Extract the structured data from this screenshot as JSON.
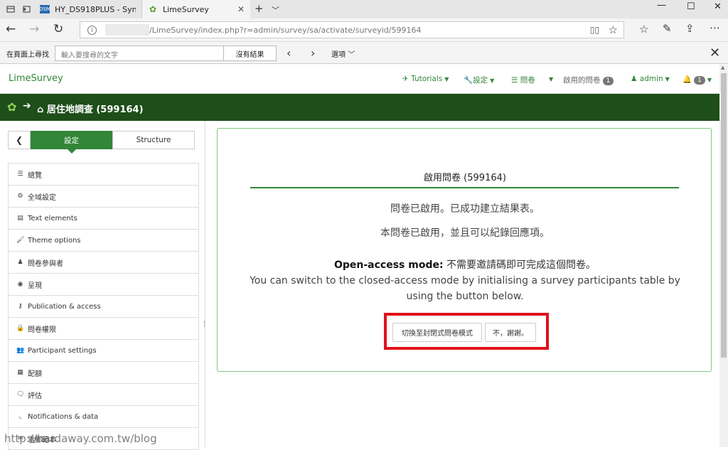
{
  "browser": {
    "tabs": [
      {
        "title": "HY_DS918PLUS - Synology DiskStation",
        "favicon": "DSM"
      },
      {
        "title": "LimeSurvey",
        "active": true
      }
    ],
    "url": "/LimeSurvey/index.php?r=admin/survey/sa/activate/surveyid/599164",
    "find": {
      "label": "在頁面上尋找",
      "placeholder": "輸入要搜尋的文字",
      "result": "沒有結果",
      "options": "選項"
    }
  },
  "nav": {
    "brand": "LimeSurvey",
    "tutorials": "Tutorials",
    "settings": "設定",
    "surveys": "問卷",
    "active_surveys": "啟用的問卷",
    "active_surveys_count": "1",
    "user": "admin",
    "notifications_count": "1"
  },
  "survey_bar": {
    "title": "居住地調查 (599164)"
  },
  "sidebar": {
    "tab_settings": "設定",
    "tab_structure": "Structure",
    "items": [
      {
        "label": "總覽",
        "icon": "list-icon"
      },
      {
        "label": "全域設定",
        "icon": "cogs-icon"
      },
      {
        "label": "Text elements",
        "icon": "file-text-icon"
      },
      {
        "label": "Theme options",
        "icon": "paint-brush-icon"
      },
      {
        "label": "問卷參與者",
        "icon": "user-icon"
      },
      {
        "label": "呈現",
        "icon": "eye-slash-icon"
      },
      {
        "label": "Publication & access",
        "icon": "key-icon"
      },
      {
        "label": "問卷權限",
        "icon": "lock-icon"
      },
      {
        "label": "Participant settings",
        "icon": "users-icon"
      },
      {
        "label": "配額",
        "icon": "tasks-icon"
      },
      {
        "label": "評估",
        "icon": "comment-icon"
      },
      {
        "label": "Notifications & data",
        "icon": "feed-icon"
      },
      {
        "label": "電郵範本",
        "icon": "envelope-icon"
      }
    ]
  },
  "card": {
    "title": "啟用問卷 (599164)",
    "line1": "問卷已啟用。已成功建立結果表。",
    "line2": "本問卷已啟用，並且可以紀錄回應項。",
    "mode_label": "Open-access mode:",
    "mode_text": " 不需要邀請碼即可完成這個問卷。",
    "line4": "You can switch to the closed-access mode by initialising a survey participants table by using the button below.",
    "switch_button": "切換至封閉式問卷模式",
    "no_button": "不，謝謝。"
  },
  "watermark": "http://hardaway.com.tw/blog",
  "colors": {
    "brand_green": "#328637",
    "header_dark_green": "#1e4e1a",
    "highlight_red": "#e0121a"
  }
}
